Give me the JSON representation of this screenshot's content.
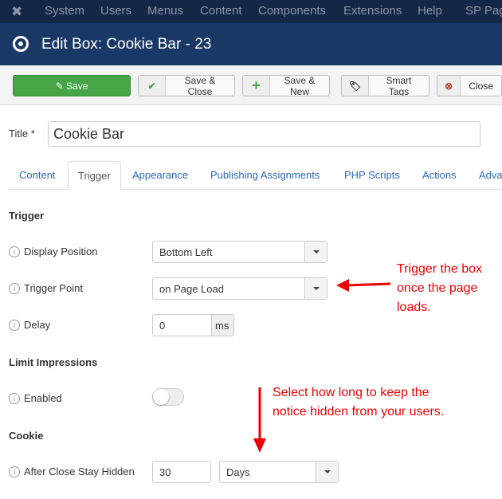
{
  "nav": {
    "items": [
      "System",
      "Users",
      "Menus",
      "Content",
      "Components",
      "Extensions",
      "Help",
      "SP Pag"
    ]
  },
  "header": {
    "title": "Edit Box: Cookie Bar - 23"
  },
  "toolbar": {
    "save": "Save",
    "save_close": "Save & Close",
    "save_new": "Save & New",
    "smart_tags": "Smart Tags",
    "close": "Close"
  },
  "form": {
    "title_label": "Title *",
    "title_value": "Cookie Bar"
  },
  "tabs": [
    "Content",
    "Trigger",
    "Appearance",
    "Publishing Assignments",
    "PHP Scripts",
    "Actions",
    "Adva"
  ],
  "trigger": {
    "heading": "Trigger",
    "display_position_label": "Display Position",
    "display_position": "Bottom Left",
    "trigger_point_label": "Trigger Point",
    "trigger_point": "on Page Load",
    "delay_label": "Delay",
    "delay": "0",
    "delay_unit": "ms"
  },
  "limit": {
    "heading": "Limit Impressions",
    "enabled_label": "Enabled",
    "enabled": false
  },
  "cookie": {
    "heading": "Cookie",
    "stay_hidden_label": "After Close Stay Hidden",
    "stay_hidden": "30",
    "unit": "Days"
  },
  "annotations": {
    "a1": [
      "Trigger the box",
      "once the page",
      "loads."
    ],
    "a2": [
      "Select how long to keep the",
      "notice hidden from your users."
    ],
    "color": "#e00000"
  }
}
